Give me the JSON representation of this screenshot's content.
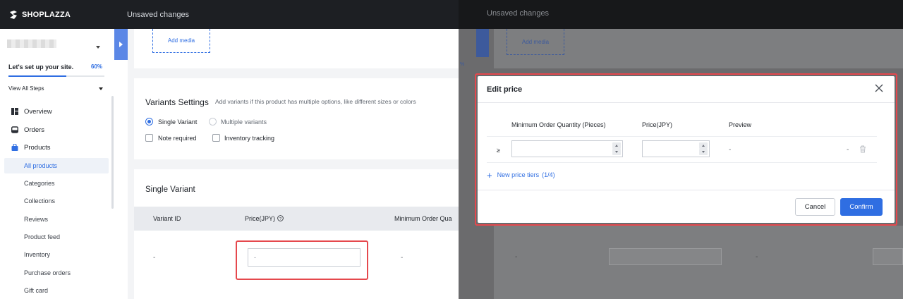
{
  "header": {
    "brand": "SHOPLAZZA",
    "status": "Unsaved changes"
  },
  "sidebar": {
    "setup_label": "Let's set up your site.",
    "setup_percent": "60%",
    "setup_progress": 0.6,
    "view_all": "View All Steps",
    "items": [
      {
        "label": "Overview",
        "icon": "overview-icon"
      },
      {
        "label": "Orders",
        "icon": "orders-icon"
      },
      {
        "label": "Products",
        "icon": "products-icon"
      }
    ],
    "sub_items": [
      "All products",
      "Categories",
      "Collections",
      "Reviews",
      "Product feed",
      "Inventory",
      "Purchase orders",
      "Gift card"
    ]
  },
  "media": {
    "add_label": "Add media"
  },
  "variants_settings": {
    "title": "Variants Settings",
    "hint": "Add variants if this product has multiple options, like different sizes or colors",
    "single": "Single Variant",
    "multiple": "Multiple variants",
    "note_required": "Note required",
    "inventory_tracking": "Inventory tracking"
  },
  "single_variant": {
    "title": "Single Variant",
    "columns": [
      "Variant ID",
      "Price(JPY)",
      "Minimum Order Qua"
    ],
    "row": {
      "variant_id": "-",
      "price_placeholder": "-",
      "min_qty": "-"
    }
  },
  "modal": {
    "title": "Edit price",
    "columns": [
      "Minimum Order Quantity (Pieces)",
      "Price(JPY)",
      "Preview"
    ],
    "row": {
      "operator": "≥",
      "preview": "-",
      "extra": "-"
    },
    "new_tier": "New price tiers",
    "tier_count": "(1/4)",
    "cancel": "Cancel",
    "confirm": "Confirm"
  },
  "background": {
    "status": "Unsaved changes",
    "add_media": "Add media",
    "pct": "%",
    "dash": "-"
  }
}
